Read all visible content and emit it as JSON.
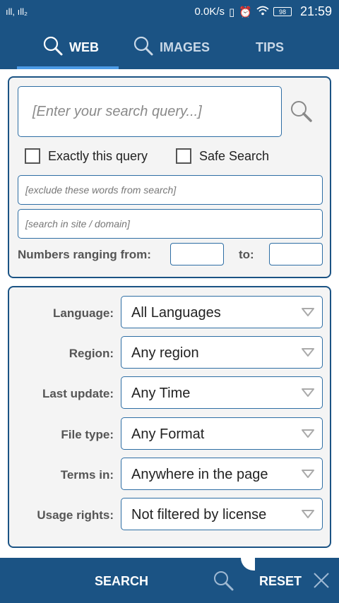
{
  "status_bar": {
    "signal": "ıll, ıll₂",
    "speed": "0.0K/s",
    "battery": "98",
    "time": "21:59"
  },
  "tabs": [
    {
      "label": "WEB",
      "icon": "search-icon",
      "active": true
    },
    {
      "label": "IMAGES",
      "icon": "search-icon",
      "active": false
    },
    {
      "label": "TIPS",
      "active": false
    }
  ],
  "query": {
    "placeholder": "[Enter your search query...]",
    "exact_label": "Exactly this query",
    "safe_label": "Safe Search",
    "exclude_placeholder": "[exclude these words from search]",
    "site_placeholder": "[search in site / domain]",
    "numbers_label": "Numbers ranging from:",
    "to_label": "to:"
  },
  "filters": [
    {
      "label": "Language:",
      "value": "All Languages"
    },
    {
      "label": "Region:",
      "value": "Any region"
    },
    {
      "label": "Last update:",
      "value": "Any Time"
    },
    {
      "label": "File type:",
      "value": "Any Format"
    },
    {
      "label": "Terms in:",
      "value": "Anywhere in the page"
    },
    {
      "label": "Usage rights:",
      "value": "Not filtered by license"
    }
  ],
  "bottom": {
    "search_label": "SEARCH",
    "reset_label": "RESET"
  },
  "colors": {
    "primary": "#1b5384",
    "accent": "#4c9be6",
    "border": "#2e6ea4"
  }
}
